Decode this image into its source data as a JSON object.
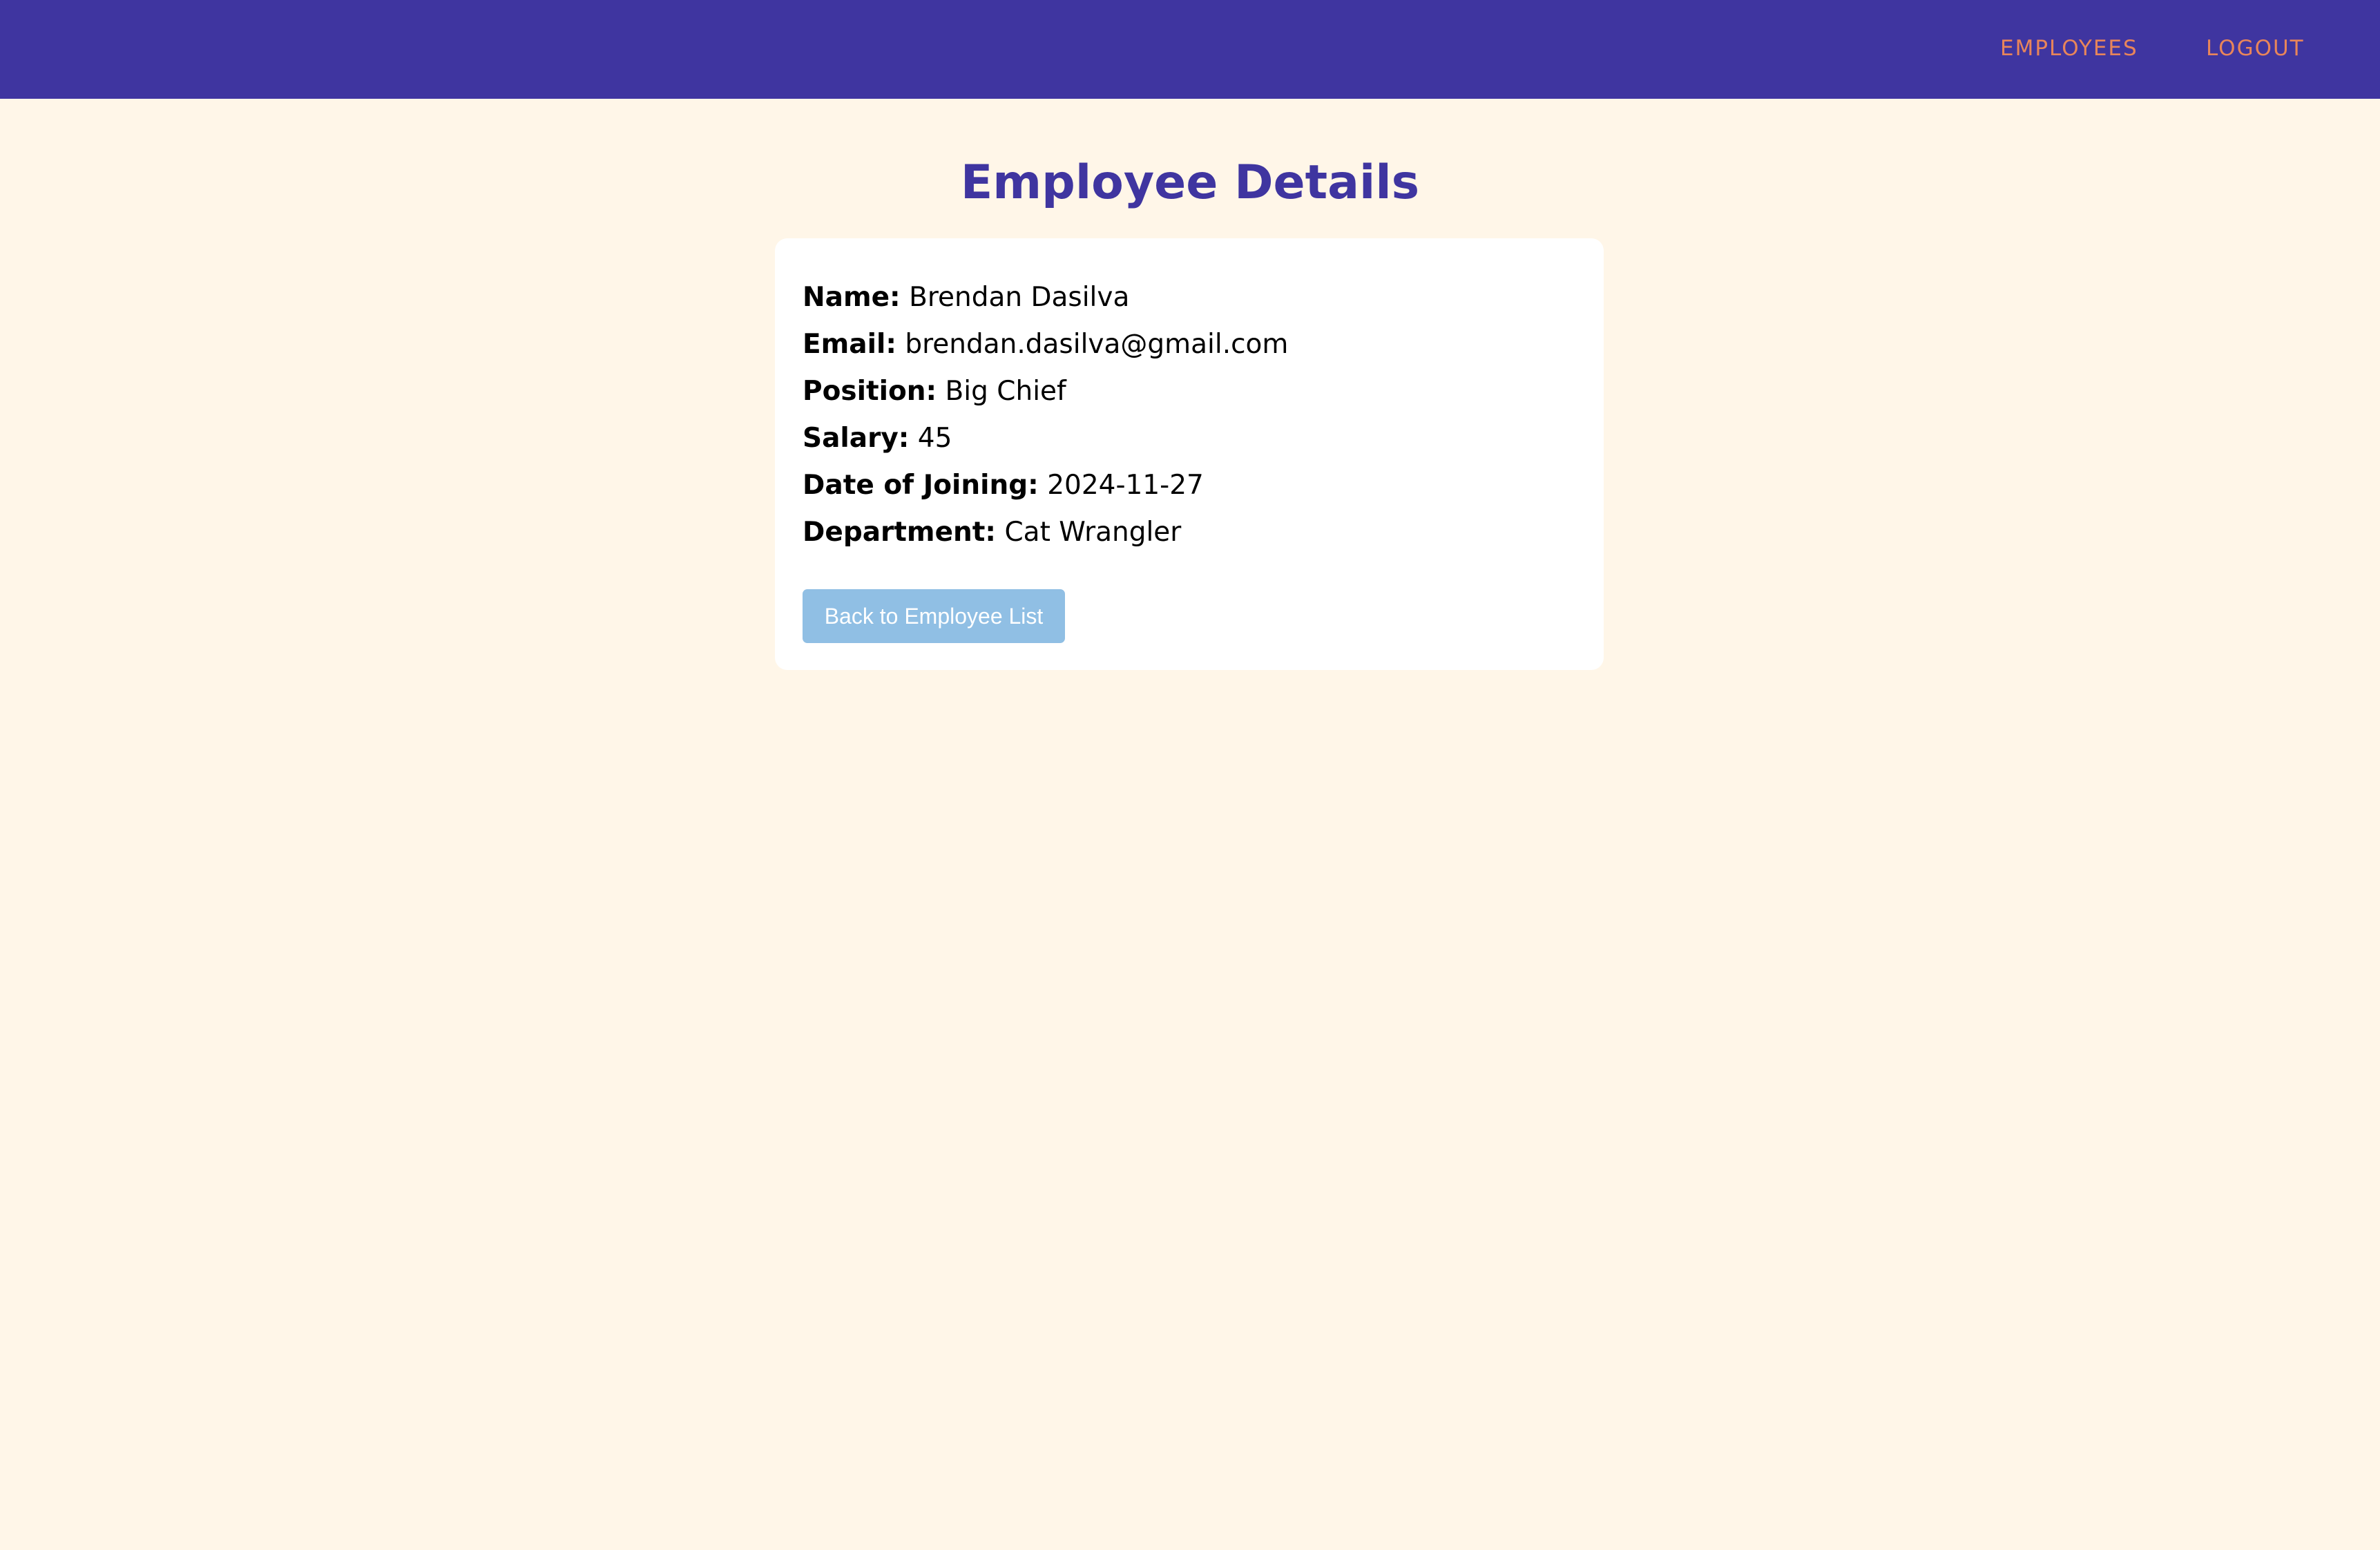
{
  "colors": {
    "navbar_bg": "#3F35A0",
    "nav_link": "#E8855A",
    "page_bg": "#FFF6E8",
    "title": "#3F35A0",
    "card_bg": "#FFFFFF",
    "button_bg": "#90BFE4"
  },
  "nav": {
    "links": [
      {
        "label": "EMPLOYEES"
      },
      {
        "label": "LOGOUT"
      }
    ]
  },
  "page": {
    "title": "Employee Details"
  },
  "details": {
    "fields": [
      {
        "label": "Name:",
        "value": "Brendan Dasilva"
      },
      {
        "label": "Email:",
        "value": "brendan.dasilva@gmail.com"
      },
      {
        "label": "Position:",
        "value": "Big Chief"
      },
      {
        "label": "Salary:",
        "value": "45"
      },
      {
        "label": "Date of Joining:",
        "value": "2024-11-27"
      },
      {
        "label": "Department:",
        "value": "Cat Wrangler"
      }
    ],
    "back_button_label": "Back to Employee List"
  }
}
